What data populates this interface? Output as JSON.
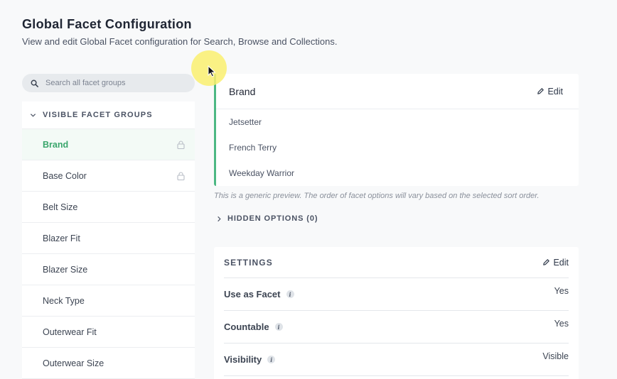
{
  "header": {
    "title": "Global Facet Configuration",
    "subtitle": "View and edit Global Facet configuration for Search, Browse and Collections."
  },
  "search": {
    "placeholder": "Search all facet groups",
    "icon": "search-icon"
  },
  "sidebar": {
    "group_label": "VISIBLE FACET GROUPS",
    "items": [
      {
        "label": "Brand",
        "locked": true,
        "active": true
      },
      {
        "label": "Base Color",
        "locked": true,
        "active": false
      },
      {
        "label": "Belt Size",
        "locked": false,
        "active": false
      },
      {
        "label": "Blazer Fit",
        "locked": false,
        "active": false
      },
      {
        "label": "Blazer Size",
        "locked": false,
        "active": false
      },
      {
        "label": "Neck Type",
        "locked": false,
        "active": false
      },
      {
        "label": "Outerwear Fit",
        "locked": false,
        "active": false
      },
      {
        "label": "Outerwear Size",
        "locked": false,
        "active": false
      }
    ]
  },
  "preview": {
    "title": "Brand",
    "edit_label": "Edit",
    "options": [
      "Jetsetter",
      "French Terry",
      "Weekday Warrior"
    ],
    "note": "This is a generic preview. The order of facet options will vary based on the selected sort order.",
    "hidden_options_label": "HIDDEN OPTIONS (0)"
  },
  "settings": {
    "title": "SETTINGS",
    "edit_label": "Edit",
    "rows": [
      {
        "label": "Use as Facet",
        "value": "Yes"
      },
      {
        "label": "Countable",
        "value": "Yes"
      },
      {
        "label": "Visibility",
        "value": "Visible"
      }
    ]
  },
  "colors": {
    "accent_green": "#4cb883",
    "active_text": "#3aa66c",
    "cursor_highlight": "#faf06e"
  }
}
